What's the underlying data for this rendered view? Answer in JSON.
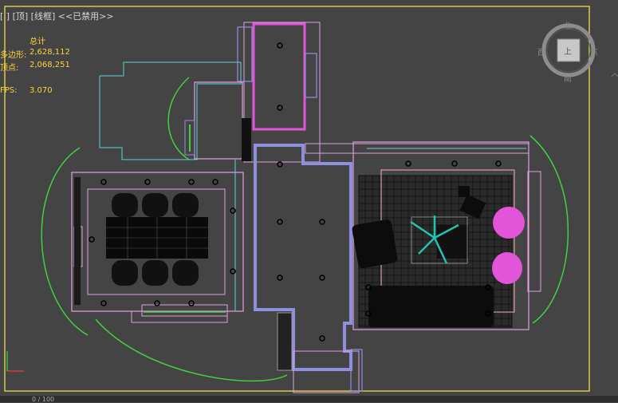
{
  "viewport": {
    "label": "[ ] [顶] [线框] <<已禁用>>",
    "label_parts": [
      "[",
      "]",
      "[顶]",
      "[线框]",
      "<<已禁用>>"
    ]
  },
  "stats": {
    "title": "总计",
    "polys_label": "多边形:",
    "polys_value": "2,628,112",
    "verts_label": "顶点:",
    "verts_value": "2,068,251",
    "fps_label": "FPS:",
    "fps_value": "3.070"
  },
  "viewcube": {
    "north": "北",
    "south": "南",
    "east": "东",
    "west": "西",
    "face": "上"
  },
  "status": {
    "text": "0 / 100"
  },
  "colors": {
    "background": "#444444",
    "frame": "#d6c94a",
    "wall": "#8f8fe0",
    "magenta": "#e255d9",
    "pink": "#e1a0e0",
    "green": "#3fd23f",
    "cyan": "#5fd0d6",
    "teal": "#22c4b0",
    "stats": "#ffd23a",
    "rug": "#d8a0a0"
  }
}
